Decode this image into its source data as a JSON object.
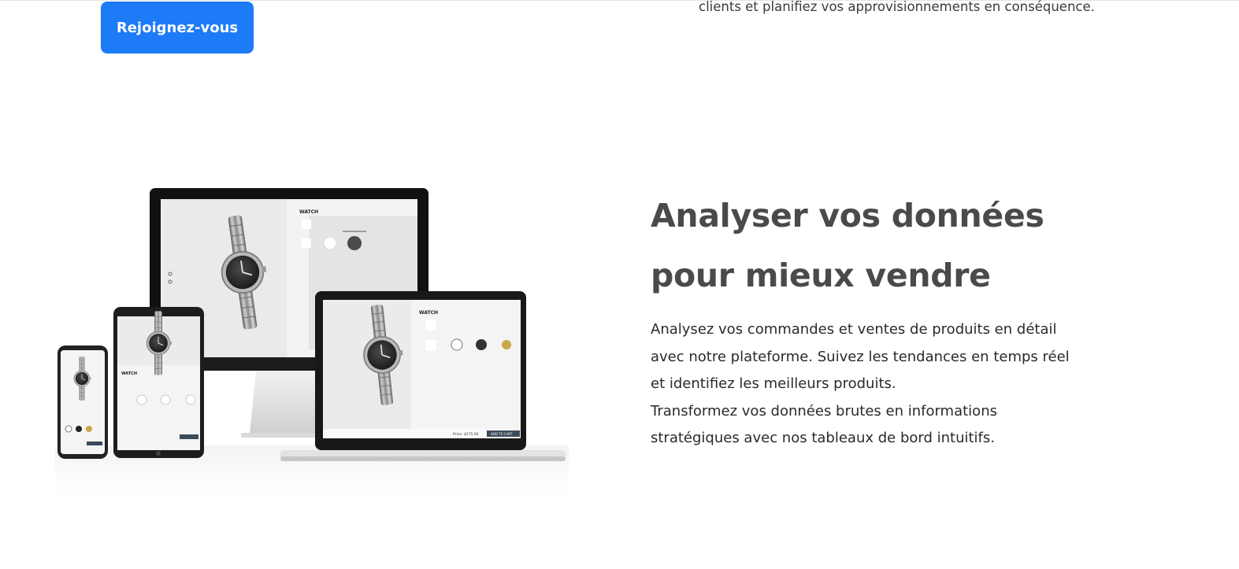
{
  "top": {
    "cta_label": "Rejoignez-vous",
    "cutoff_text": "clients et planifiez vos approvisionnements en conséquence."
  },
  "section": {
    "title": "Analyser vos données pour mieux vendre",
    "paragraph1": "Analysez vos commandes et ventes de produits en détail avec notre plateforme. Suivez les tendances en temps réel et identifiez les meilleurs produits.",
    "paragraph2": "Transformez vos données brutes en informations stratégiques avec nos tableaux de bord intuitifs."
  },
  "mockup": {
    "watch_label": "WATCH",
    "price_label": "Price: $275.00",
    "add_to_cart_label": "ADD TO CART"
  },
  "colors": {
    "accent": "#1d7bf7",
    "heading": "#4a4a4a"
  }
}
